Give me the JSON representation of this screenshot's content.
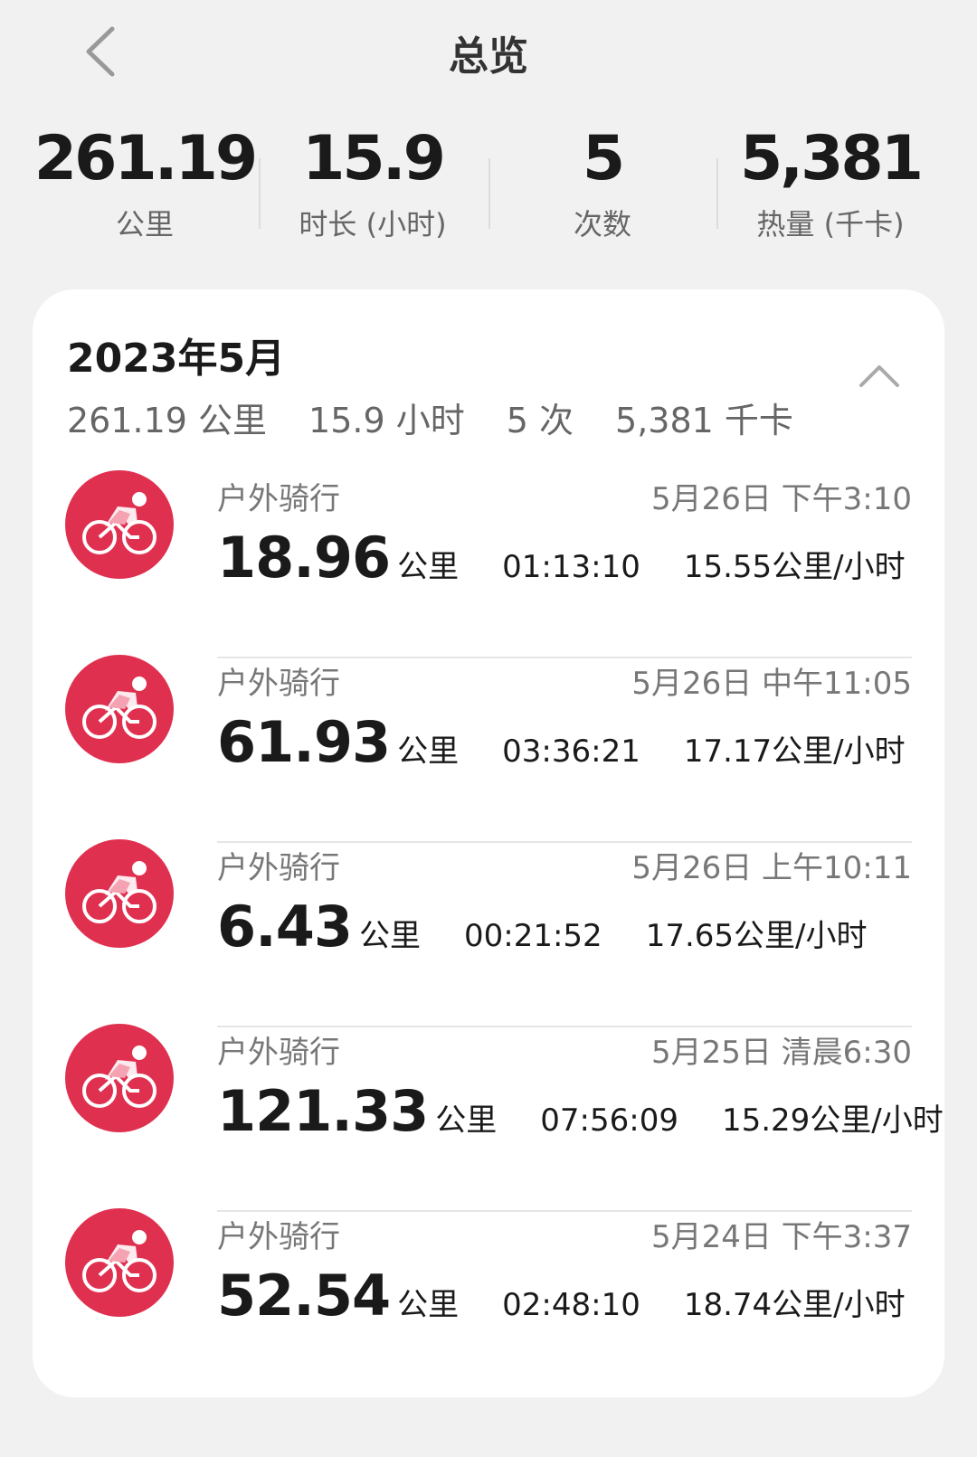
{
  "header": {
    "title": "总览"
  },
  "summary": [
    {
      "value": "261.19",
      "label": "公里"
    },
    {
      "value": "15.9",
      "label": "时长 (小时)"
    },
    {
      "value": "5",
      "label": "次数"
    },
    {
      "value": "5,381",
      "label": "热量 (千卡)"
    }
  ],
  "month": {
    "title": "2023年5月",
    "distance": "261.19 公里",
    "duration": "15.9 小时",
    "count": "5 次",
    "calories": "5,381 千卡"
  },
  "activities": [
    {
      "type": "户外骑行",
      "time": "5月26日 下午3:10",
      "distance": "18.96",
      "unit": "公里",
      "duration": "01:13:10",
      "speed": "15.55公里/小时"
    },
    {
      "type": "户外骑行",
      "time": "5月26日 中午11:05",
      "distance": "61.93",
      "unit": "公里",
      "duration": "03:36:21",
      "speed": "17.17公里/小时"
    },
    {
      "type": "户外骑行",
      "time": "5月26日 上午10:11",
      "distance": "6.43",
      "unit": "公里",
      "duration": "00:21:52",
      "speed": "17.65公里/小时"
    },
    {
      "type": "户外骑行",
      "time": "5月25日 清晨6:30",
      "distance": "121.33",
      "unit": "公里",
      "duration": "07:56:09",
      "speed": "15.29公里/小时"
    },
    {
      "type": "户外骑行",
      "time": "5月24日 下午3:37",
      "distance": "52.54",
      "unit": "公里",
      "duration": "02:48:10",
      "speed": "18.74公里/小时"
    }
  ],
  "icons": {
    "back": "chevron-left-icon",
    "collapse": "chevron-up-icon",
    "activity": "cycling-icon"
  },
  "colors": {
    "accent": "#e0304f",
    "background": "#f1f1f1",
    "card": "#ffffff"
  }
}
